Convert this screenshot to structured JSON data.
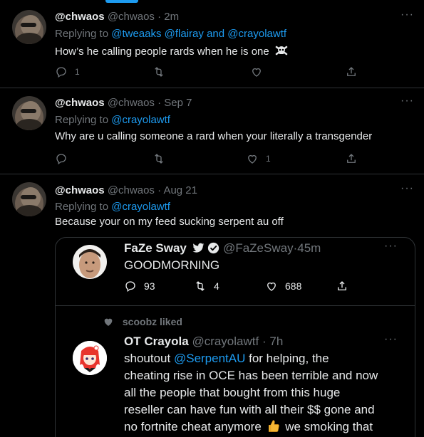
{
  "tweets": [
    {
      "name": "@chwaos",
      "handle": "@chwaos",
      "dot": "·",
      "time": "2m",
      "replying_prefix": "Replying to",
      "replying_to": [
        "@tweaaks",
        "@flairay",
        "@crayolawtf"
      ],
      "replying_joiner": "and",
      "text": "How’s he calling people rards when he is one",
      "emoji": "skull-and-crossbones",
      "reply_count": "1",
      "retweet_count": "",
      "like_count": ""
    },
    {
      "name": "@chwaos",
      "handle": "@chwaos",
      "dot": "·",
      "time": "Sep 7",
      "replying_prefix": "Replying to",
      "replying_to": [
        "@crayolawtf"
      ],
      "text": "Why are u calling someone a rard when your literally a transgender",
      "reply_count": "",
      "retweet_count": "",
      "like_count": "1"
    },
    {
      "name": "@chwaos",
      "handle": "@chwaos",
      "dot": "·",
      "time": "Aug 21",
      "replying_prefix": "Replying to",
      "replying_to": [
        "@crayolawtf"
      ],
      "text": "Because your on my feed sucking serpent au off"
    }
  ],
  "quote": {
    "tweet1": {
      "name": "FaZe Sway",
      "handle": "@FaZeSway",
      "dot": "·",
      "time": "45m",
      "text": "GOODMORNING",
      "reply_count": "93",
      "retweet_count": "4",
      "like_count": "688"
    },
    "liked_by": "scoobz liked",
    "tweet2": {
      "name": "OT Crayola",
      "handle": "@crayolawtf",
      "dot": "·",
      "time": "7h",
      "line1_prefix": "shoutout",
      "line1_mention": "@SerpentAU",
      "line1_suffix": "for helping, the",
      "line2": "cheating rise in OCE has been terrible and now",
      "line3": "all the people that bought from this huge",
      "line4": "reseller can have fun with all their $$ gone and",
      "line5_prefix": "no fortnite cheat anymore",
      "line5_suffix": "we smoking that",
      "emoji": "thumbs-up"
    }
  },
  "more_glyph": "···",
  "colors": {
    "background": "#000000",
    "text": "#e7e9ea",
    "muted": "#71767b",
    "link": "#1d9bf0",
    "border": "#2f3336"
  }
}
